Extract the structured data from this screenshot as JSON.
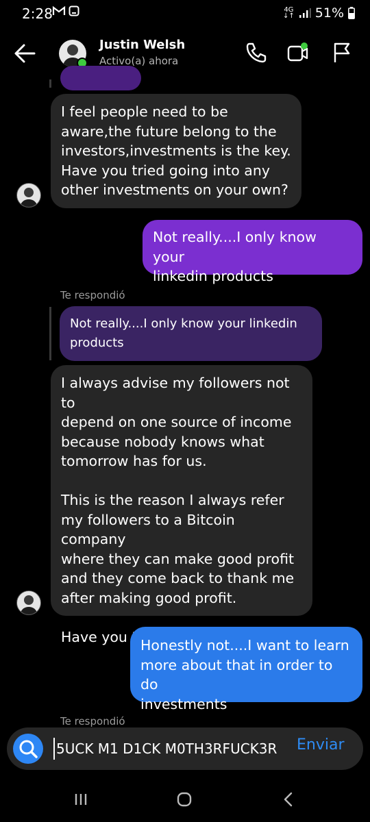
{
  "status_bar": {
    "time": "2:28",
    "network": "4G",
    "battery": "51%"
  },
  "header": {
    "name": "Justin Welsh",
    "status": "Activo(a) ahora"
  },
  "messages": [
    {
      "text": "I feel people need to be\naware,the future belong to the\ninvestors,investments is the key.\nHave you tried going into any\nother investments on your own?"
    },
    {
      "text": "Not really....I only know your\nlinkedin products"
    },
    {
      "reply_label": "Te respondió",
      "quote": "Not really....I only know your linkedin\nproducts"
    },
    {
      "text": "I always advise my followers not to\ndepend on one source of income\nbecause nobody knows what\ntomorrow has for us.\n\nThis is the reason I always refer\nmy followers to a Bitcoin company\nwhere they can make good profit\nand they come back to thank me\nafter making good profit.\n\nHave you tried going into Bitcoin?"
    },
    {
      "text": "Honestly not....I want to learn\nmore about that in order to do\ninvestments"
    },
    {
      "reply_label": "Te respondió"
    }
  ],
  "composer": {
    "value": "5UCK M1 D1CK M0TH3RFUCK3R",
    "send_label": "Enviar"
  },
  "colors": {
    "received_bubble": "#262626",
    "sent_purple": "#7b2fd0",
    "sent_blue": "#2b7bea",
    "quote_bubble": "#3a2463",
    "accent": "#2e87f5",
    "online": "#3ecb3e"
  }
}
